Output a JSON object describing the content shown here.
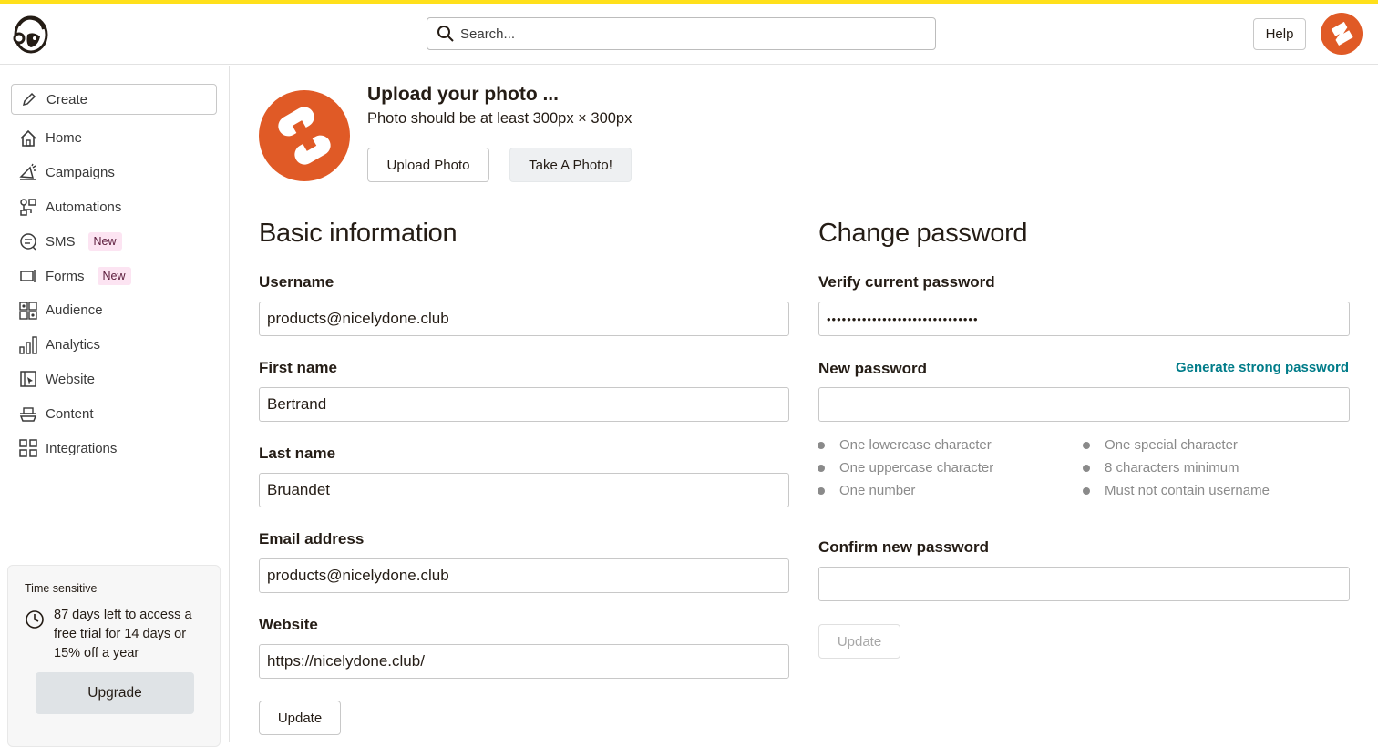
{
  "header": {
    "search_placeholder": "Search...",
    "help_label": "Help"
  },
  "colors": {
    "accent_stripe": "#ffe01b",
    "brand_orange": "#e05a26",
    "link_teal": "#007c89"
  },
  "sidebar": {
    "create_label": "Create",
    "items": [
      {
        "label": "Home",
        "icon": "home-icon"
      },
      {
        "label": "Campaigns",
        "icon": "megaphone-icon"
      },
      {
        "label": "Automations",
        "icon": "automations-icon"
      },
      {
        "label": "SMS",
        "icon": "sms-icon",
        "badge": "New"
      },
      {
        "label": "Forms",
        "icon": "forms-icon",
        "badge": "New"
      },
      {
        "label": "Audience",
        "icon": "audience-icon"
      },
      {
        "label": "Analytics",
        "icon": "analytics-icon"
      },
      {
        "label": "Website",
        "icon": "website-icon"
      },
      {
        "label": "Content",
        "icon": "content-icon"
      },
      {
        "label": "Integrations",
        "icon": "integrations-icon"
      }
    ],
    "promo": {
      "title": "Time sensitive",
      "text": "87 days left to access a free trial for 14 days or 15% off a year",
      "button": "Upgrade"
    }
  },
  "photo": {
    "title": "Upload your photo ...",
    "subtitle": "Photo should be at least 300px × 300px",
    "upload_button": "Upload Photo",
    "take_button": "Take A Photo!"
  },
  "basic": {
    "heading": "Basic information",
    "username_label": "Username",
    "username_value": "products@nicelydone.club",
    "first_label": "First name",
    "first_value": "Bertrand",
    "last_label": "Last name",
    "last_value": "Bruandet",
    "email_label": "Email address",
    "email_value": "products@nicelydone.club",
    "website_label": "Website",
    "website_value": "https://nicelydone.club/",
    "update_button": "Update"
  },
  "password": {
    "heading": "Change password",
    "verify_label": "Verify current password",
    "verify_value": "••••••••••••••••••••••••••••••",
    "new_label": "New password",
    "generate_link": "Generate strong password",
    "requirements_left": [
      "One lowercase character",
      "One uppercase character",
      "One number"
    ],
    "requirements_right": [
      "One special character",
      "8 characters minimum",
      "Must not contain username"
    ],
    "confirm_label": "Confirm new password",
    "update_button": "Update"
  }
}
